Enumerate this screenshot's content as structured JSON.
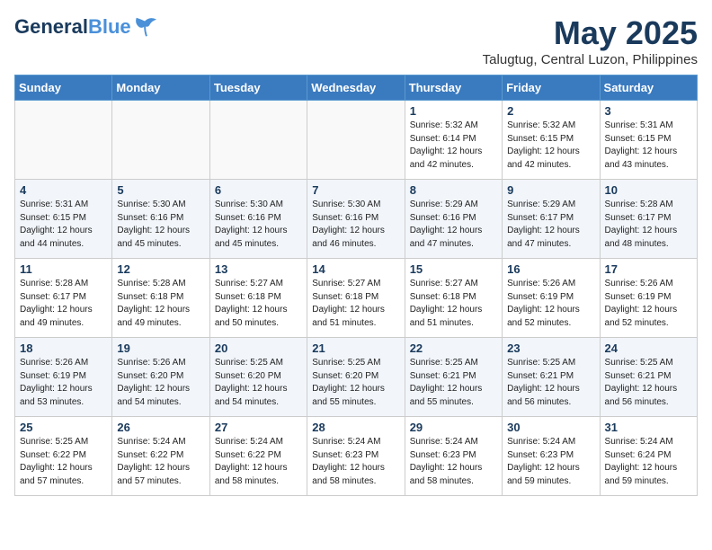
{
  "logo": {
    "line1": "General",
    "line2": "Blue"
  },
  "title": "May 2025",
  "location": "Talugtug, Central Luzon, Philippines",
  "days_of_week": [
    "Sunday",
    "Monday",
    "Tuesday",
    "Wednesday",
    "Thursday",
    "Friday",
    "Saturday"
  ],
  "weeks": [
    [
      {
        "day": "",
        "info": ""
      },
      {
        "day": "",
        "info": ""
      },
      {
        "day": "",
        "info": ""
      },
      {
        "day": "",
        "info": ""
      },
      {
        "day": "1",
        "info": "Sunrise: 5:32 AM\nSunset: 6:14 PM\nDaylight: 12 hours\nand 42 minutes."
      },
      {
        "day": "2",
        "info": "Sunrise: 5:32 AM\nSunset: 6:15 PM\nDaylight: 12 hours\nand 42 minutes."
      },
      {
        "day": "3",
        "info": "Sunrise: 5:31 AM\nSunset: 6:15 PM\nDaylight: 12 hours\nand 43 minutes."
      }
    ],
    [
      {
        "day": "4",
        "info": "Sunrise: 5:31 AM\nSunset: 6:15 PM\nDaylight: 12 hours\nand 44 minutes."
      },
      {
        "day": "5",
        "info": "Sunrise: 5:30 AM\nSunset: 6:16 PM\nDaylight: 12 hours\nand 45 minutes."
      },
      {
        "day": "6",
        "info": "Sunrise: 5:30 AM\nSunset: 6:16 PM\nDaylight: 12 hours\nand 45 minutes."
      },
      {
        "day": "7",
        "info": "Sunrise: 5:30 AM\nSunset: 6:16 PM\nDaylight: 12 hours\nand 46 minutes."
      },
      {
        "day": "8",
        "info": "Sunrise: 5:29 AM\nSunset: 6:16 PM\nDaylight: 12 hours\nand 47 minutes."
      },
      {
        "day": "9",
        "info": "Sunrise: 5:29 AM\nSunset: 6:17 PM\nDaylight: 12 hours\nand 47 minutes."
      },
      {
        "day": "10",
        "info": "Sunrise: 5:28 AM\nSunset: 6:17 PM\nDaylight: 12 hours\nand 48 minutes."
      }
    ],
    [
      {
        "day": "11",
        "info": "Sunrise: 5:28 AM\nSunset: 6:17 PM\nDaylight: 12 hours\nand 49 minutes."
      },
      {
        "day": "12",
        "info": "Sunrise: 5:28 AM\nSunset: 6:18 PM\nDaylight: 12 hours\nand 49 minutes."
      },
      {
        "day": "13",
        "info": "Sunrise: 5:27 AM\nSunset: 6:18 PM\nDaylight: 12 hours\nand 50 minutes."
      },
      {
        "day": "14",
        "info": "Sunrise: 5:27 AM\nSunset: 6:18 PM\nDaylight: 12 hours\nand 51 minutes."
      },
      {
        "day": "15",
        "info": "Sunrise: 5:27 AM\nSunset: 6:18 PM\nDaylight: 12 hours\nand 51 minutes."
      },
      {
        "day": "16",
        "info": "Sunrise: 5:26 AM\nSunset: 6:19 PM\nDaylight: 12 hours\nand 52 minutes."
      },
      {
        "day": "17",
        "info": "Sunrise: 5:26 AM\nSunset: 6:19 PM\nDaylight: 12 hours\nand 52 minutes."
      }
    ],
    [
      {
        "day": "18",
        "info": "Sunrise: 5:26 AM\nSunset: 6:19 PM\nDaylight: 12 hours\nand 53 minutes."
      },
      {
        "day": "19",
        "info": "Sunrise: 5:26 AM\nSunset: 6:20 PM\nDaylight: 12 hours\nand 54 minutes."
      },
      {
        "day": "20",
        "info": "Sunrise: 5:25 AM\nSunset: 6:20 PM\nDaylight: 12 hours\nand 54 minutes."
      },
      {
        "day": "21",
        "info": "Sunrise: 5:25 AM\nSunset: 6:20 PM\nDaylight: 12 hours\nand 55 minutes."
      },
      {
        "day": "22",
        "info": "Sunrise: 5:25 AM\nSunset: 6:21 PM\nDaylight: 12 hours\nand 55 minutes."
      },
      {
        "day": "23",
        "info": "Sunrise: 5:25 AM\nSunset: 6:21 PM\nDaylight: 12 hours\nand 56 minutes."
      },
      {
        "day": "24",
        "info": "Sunrise: 5:25 AM\nSunset: 6:21 PM\nDaylight: 12 hours\nand 56 minutes."
      }
    ],
    [
      {
        "day": "25",
        "info": "Sunrise: 5:25 AM\nSunset: 6:22 PM\nDaylight: 12 hours\nand 57 minutes."
      },
      {
        "day": "26",
        "info": "Sunrise: 5:24 AM\nSunset: 6:22 PM\nDaylight: 12 hours\nand 57 minutes."
      },
      {
        "day": "27",
        "info": "Sunrise: 5:24 AM\nSunset: 6:22 PM\nDaylight: 12 hours\nand 58 minutes."
      },
      {
        "day": "28",
        "info": "Sunrise: 5:24 AM\nSunset: 6:23 PM\nDaylight: 12 hours\nand 58 minutes."
      },
      {
        "day": "29",
        "info": "Sunrise: 5:24 AM\nSunset: 6:23 PM\nDaylight: 12 hours\nand 58 minutes."
      },
      {
        "day": "30",
        "info": "Sunrise: 5:24 AM\nSunset: 6:23 PM\nDaylight: 12 hours\nand 59 minutes."
      },
      {
        "day": "31",
        "info": "Sunrise: 5:24 AM\nSunset: 6:24 PM\nDaylight: 12 hours\nand 59 minutes."
      }
    ]
  ]
}
